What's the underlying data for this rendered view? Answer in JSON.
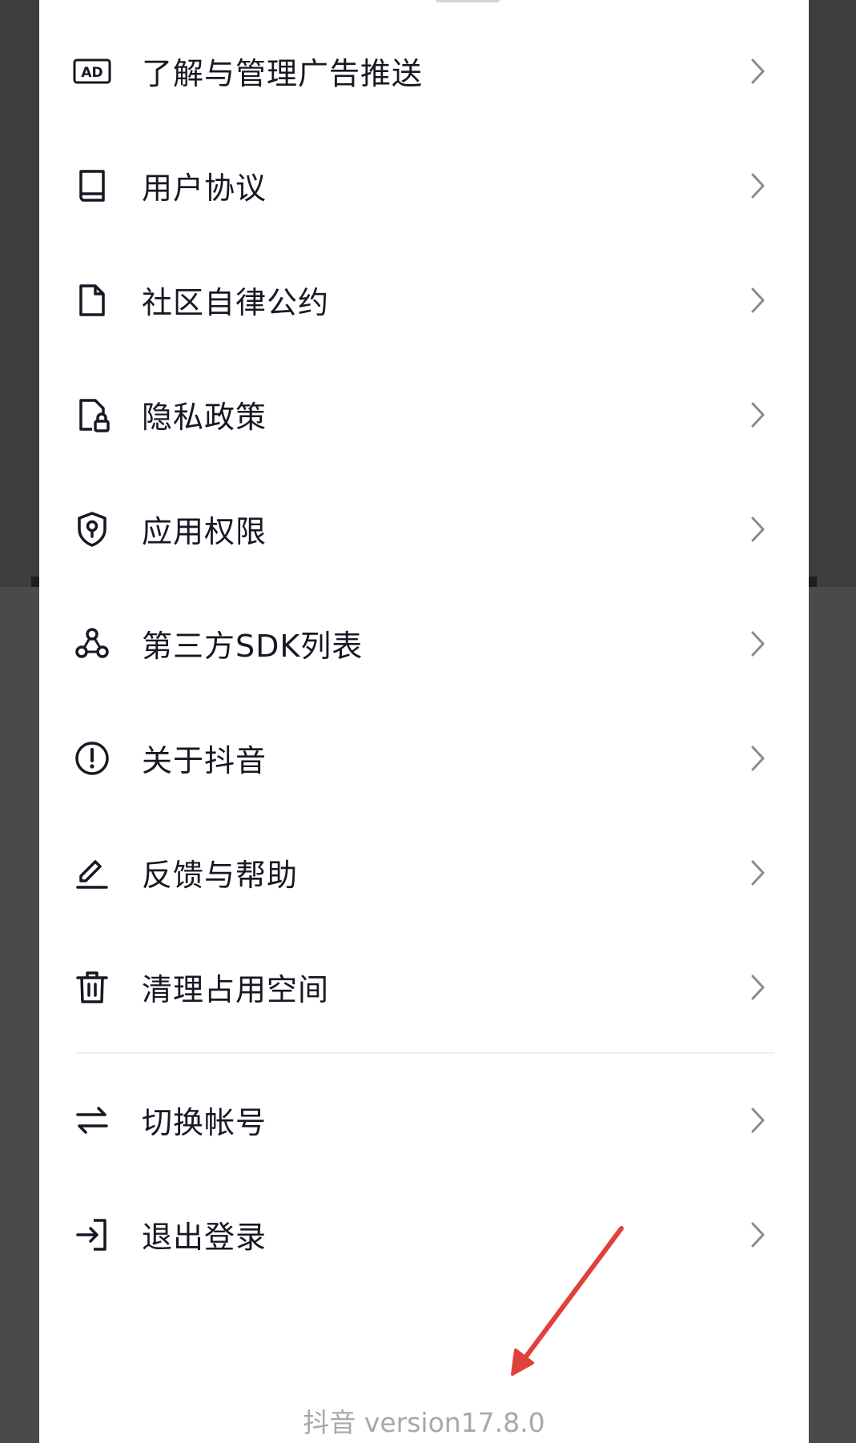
{
  "menu": {
    "items": [
      {
        "label": "了解与管理广告推送",
        "icon": "ad-icon"
      },
      {
        "label": "用户协议",
        "icon": "book-icon"
      },
      {
        "label": "社区自律公约",
        "icon": "document-icon"
      },
      {
        "label": "隐私政策",
        "icon": "privacy-lock-icon"
      },
      {
        "label": "应用权限",
        "icon": "shield-keyhole-icon"
      },
      {
        "label": "第三方SDK列表",
        "icon": "cluster-icon"
      },
      {
        "label": "关于抖音",
        "icon": "info-circle-icon"
      },
      {
        "label": "反馈与帮助",
        "icon": "pencil-icon"
      },
      {
        "label": "清理占用空间",
        "icon": "trash-icon"
      }
    ],
    "account_items": [
      {
        "label": "切换帐号",
        "icon": "switch-arrows-icon"
      },
      {
        "label": "退出登录",
        "icon": "logout-icon"
      }
    ],
    "ad_badge": "AD"
  },
  "footer": {
    "version_text": "抖音 version17.8.0"
  },
  "colors": {
    "text": "#161823",
    "muted": "#a8a8ab",
    "annotation_arrow": "#e0413a"
  }
}
